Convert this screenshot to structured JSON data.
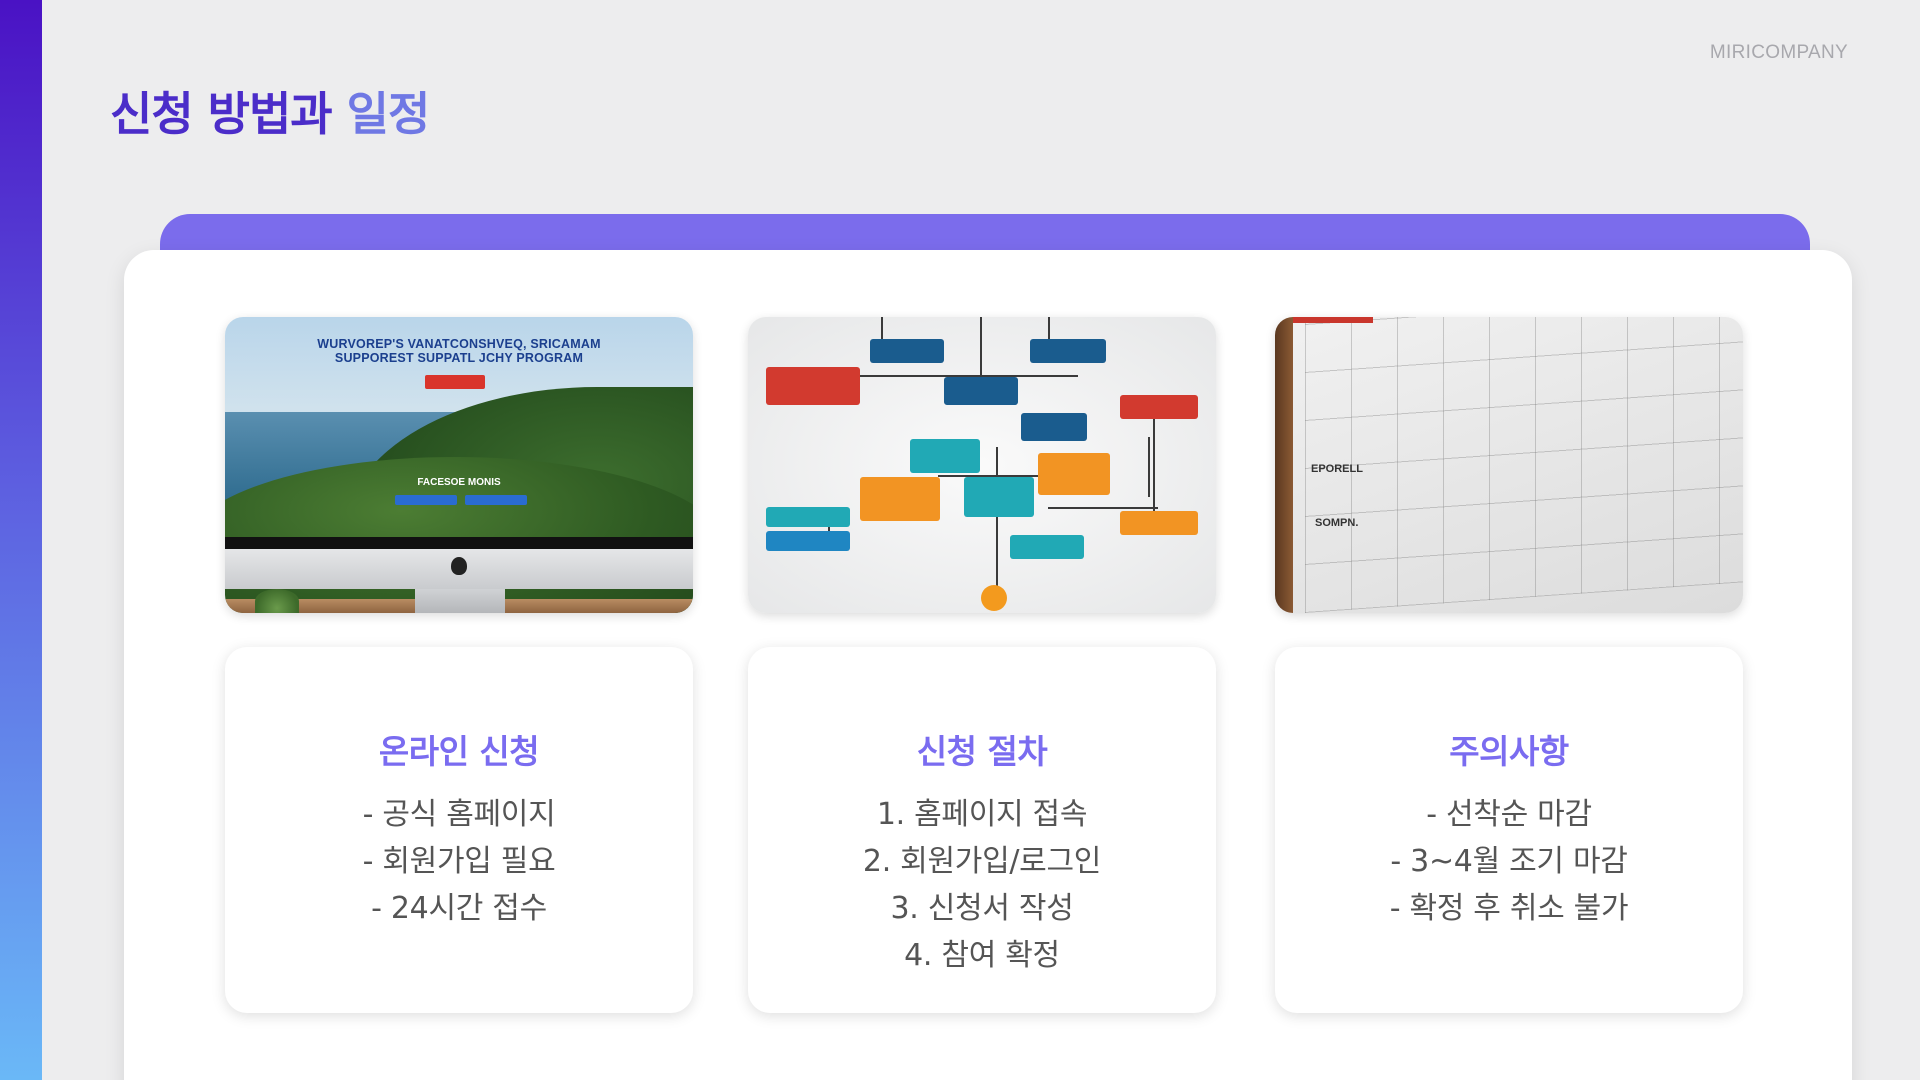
{
  "brand": "MIRICOMPANY",
  "title": {
    "part1": "신청 방법과",
    "part2": "일정"
  },
  "thumbnails": {
    "website": {
      "headline1": "WURVOREP'S VANATCONSHVEQ, SRICAMAM",
      "headline2": "SUPPOREST SUPPATL JCHY PROGRAM",
      "midtext": "FACESOE MONIS"
    },
    "calendar": {
      "side_labels": [
        "EPORELL",
        "SOMPN."
      ]
    }
  },
  "columns": [
    {
      "heading": "온라인 신청",
      "lines": [
        "- 공식 홈페이지",
        "- 회원가입 필요",
        "- 24시간 접수"
      ]
    },
    {
      "heading": "신청 절차",
      "lines": [
        "1. 홈페이지 접속",
        "2. 회원가입/로그인",
        "3. 신청서 작성",
        "4. 참여 확정"
      ]
    },
    {
      "heading": "주의사항",
      "lines": [
        "- 선착순 마감",
        "- 3~4월 조기 마감",
        "- 확정 후 취소 불가"
      ]
    }
  ],
  "colors": {
    "accent": "#7b6cec",
    "title_dark": "#4b2dc9",
    "title_light": "#6f78e4",
    "heading": "#7a6cf0",
    "body_text": "#555555"
  }
}
